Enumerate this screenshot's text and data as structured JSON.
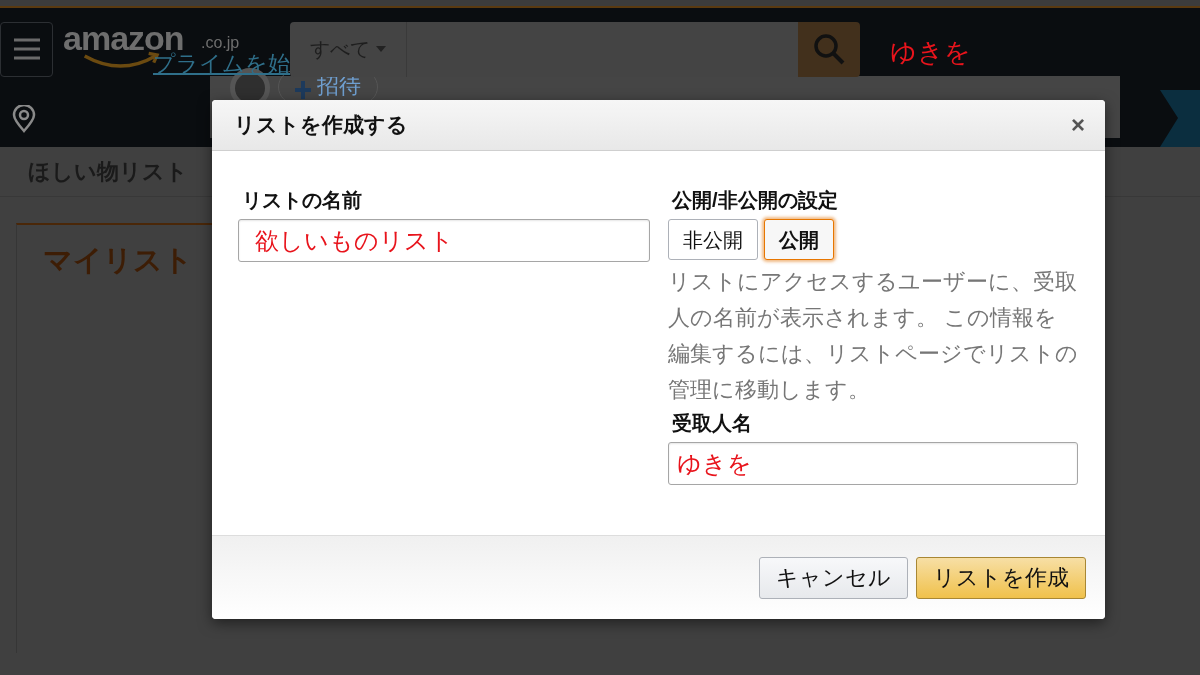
{
  "header": {
    "logo": {
      "wordmark": "amazon",
      "domain": ".co.jp"
    },
    "promo_link": "プライムを始",
    "search": {
      "category": "すべて"
    },
    "annotation": "ゆきを"
  },
  "subnav": {
    "invite": "招待"
  },
  "page": {
    "title": "ほしい物リスト",
    "tab": "マイリスト"
  },
  "dialog": {
    "title": "リストを作成する",
    "close": "×",
    "name_label": "リストの名前",
    "name_value": "欲しいものリスト",
    "privacy_label": "公開/非公開の設定",
    "privacy_options": [
      {
        "label": "非公開",
        "selected": false
      },
      {
        "label": "公開",
        "selected": true
      }
    ],
    "privacy_note": "リストにアクセスするユーザーに、受取人の名前が表示されます。 この情報を編集するには、リストページでリストの管理に移動します。",
    "recipient_label": "受取人名",
    "recipient_value": "ゆきを",
    "buttons": [
      {
        "label": "キャンセル",
        "kind": "secondary"
      },
      {
        "label": "リストを作成",
        "kind": "primary"
      }
    ]
  }
}
